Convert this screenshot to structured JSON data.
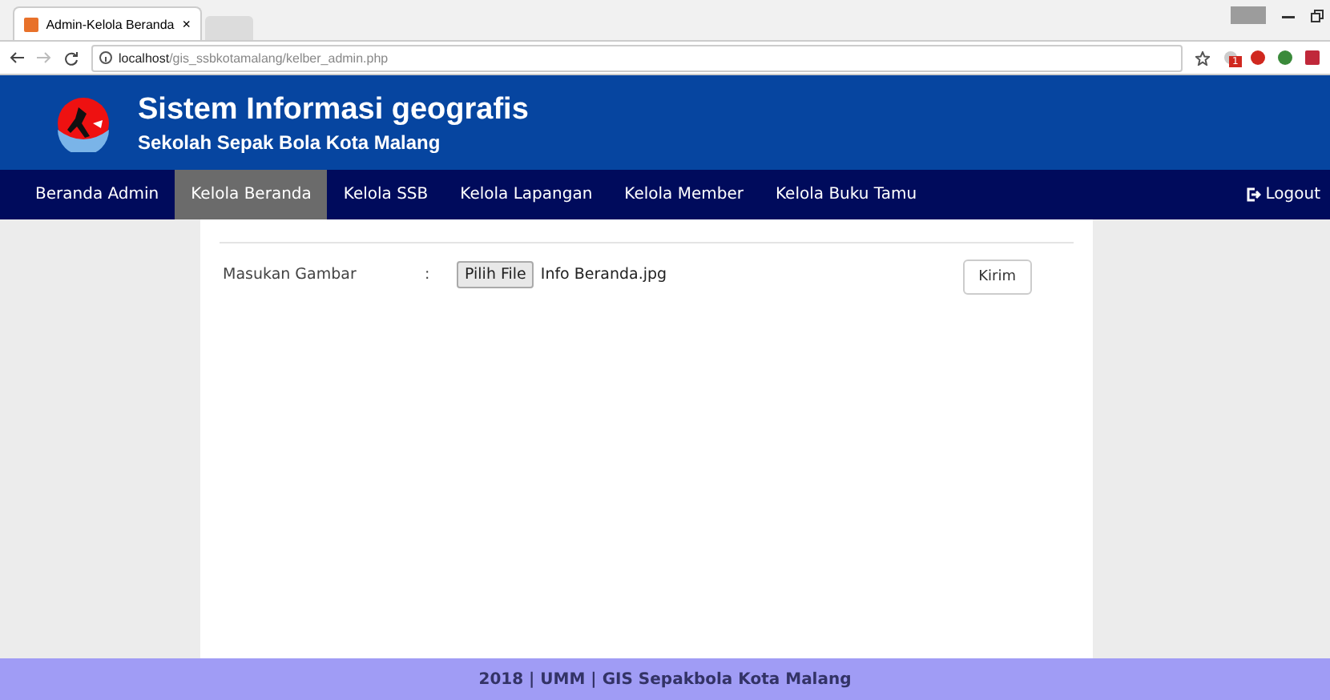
{
  "browser": {
    "tab_title": "Admin-Kelola Beranda",
    "tab_close": "×",
    "url_host": "localhost",
    "url_path": "/gis_ssbkotamalang/kelber_admin.php",
    "extension_badge": "1"
  },
  "header": {
    "title": "Sistem Informasi geografis",
    "subtitle": "Sekolah Sepak Bola Kota Malang"
  },
  "nav": {
    "items": [
      {
        "label": "Beranda Admin",
        "selected": false
      },
      {
        "label": "Kelola Beranda",
        "selected": true
      },
      {
        "label": "Kelola SSB",
        "selected": false
      },
      {
        "label": "Kelola Lapangan",
        "selected": false
      },
      {
        "label": "Kelola Member",
        "selected": false
      },
      {
        "label": "Kelola Buku Tamu",
        "selected": false
      }
    ],
    "logout": "Logout"
  },
  "form": {
    "label": "Masukan Gambar",
    "separator": ":",
    "file_button": "Pilih File",
    "file_name": "Info Beranda.jpg",
    "submit": "Kirim"
  },
  "footer": "2018 | UMM | GIS Sepakbola Kota Malang"
}
